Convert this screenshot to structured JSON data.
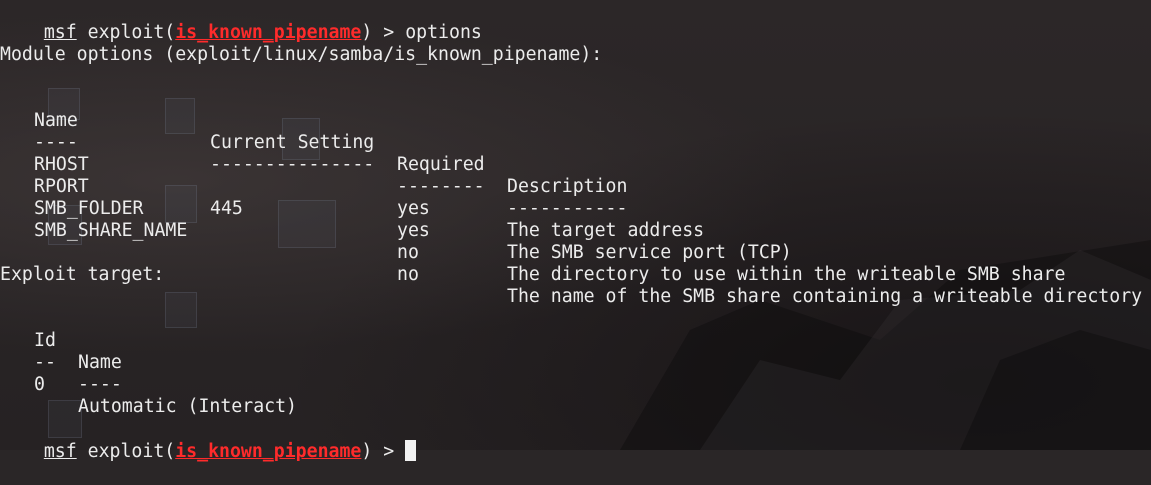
{
  "prompt": {
    "msf": "msf",
    "exploit_prefix": " exploit(",
    "module": "is_known_pipename",
    "suffix": ") > ",
    "command": "options"
  },
  "module_options": {
    "heading": "Module options (exploit/linux/samba/is_known_pipename):",
    "headers": [
      "Name",
      "Current Setting",
      "Required",
      "Description"
    ],
    "separators": [
      "----",
      "---------------",
      "--------",
      "-----------"
    ],
    "rows": [
      {
        "name": "RHOST",
        "setting": "",
        "required": "yes",
        "description": "The target address"
      },
      {
        "name": "RPORT",
        "setting": "445",
        "required": "yes",
        "description": "The SMB service port (TCP)"
      },
      {
        "name": "SMB_FOLDER",
        "setting": "",
        "required": "no",
        "description": "The directory to use within the writeable SMB share"
      },
      {
        "name": "SMB_SHARE_NAME",
        "setting": "",
        "required": "no",
        "description": "The name of the SMB share containing a writeable directory"
      }
    ]
  },
  "exploit_target": {
    "heading": "Exploit target:",
    "headers": [
      "Id",
      "Name"
    ],
    "separators": [
      "--",
      "----"
    ],
    "rows": [
      {
        "id": "0",
        "name": "Automatic (Interact)"
      }
    ]
  },
  "colors": {
    "background": "#2a2627",
    "text": "#ececec",
    "module": "#ff2b2b"
  }
}
